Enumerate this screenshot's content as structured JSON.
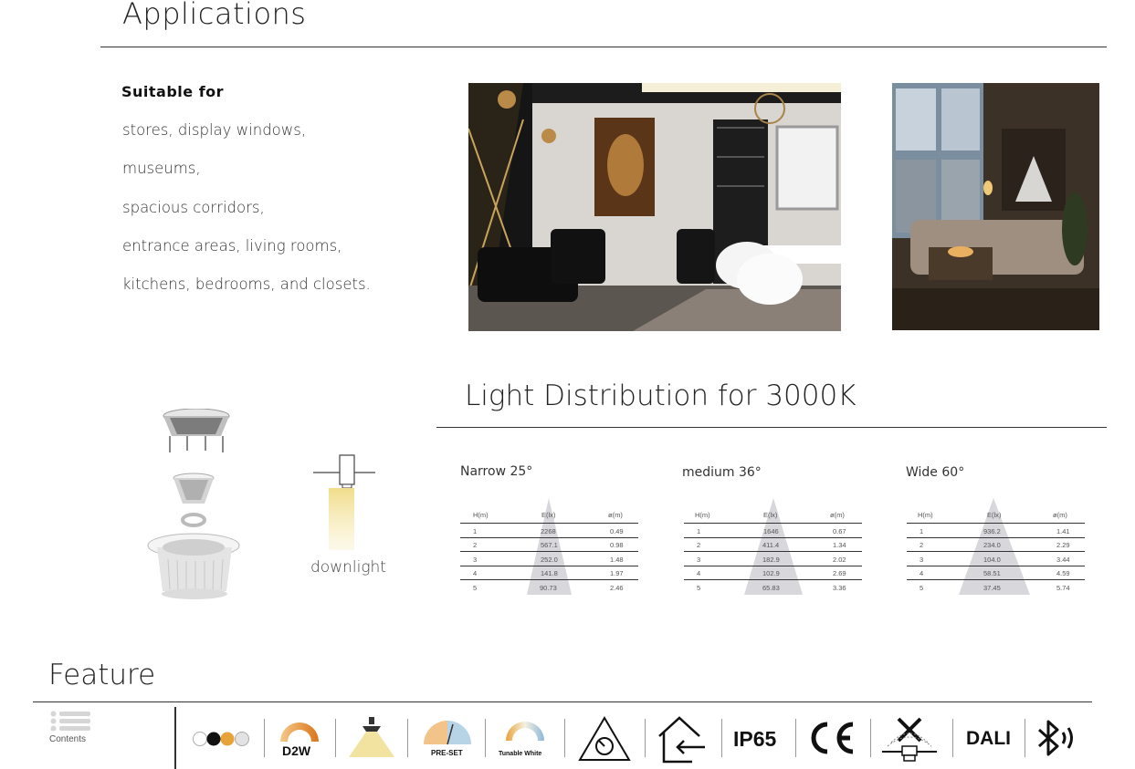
{
  "applications": {
    "title": "Applications",
    "suitable_heading": "Suitable  for",
    "suitable_items": [
      "stores, display windows,",
      " museums,",
      "spacious corridors,",
      "entrance areas, living rooms,",
      "kitchens, bedrooms, and closets."
    ]
  },
  "light_distribution": {
    "title": "Light Distribution for 3000K",
    "downlight_label": "downlight",
    "headers": [
      "H(m)",
      "E(lx)",
      "ø(m)"
    ],
    "beams": [
      {
        "label": "Narrow 25°",
        "rows": [
          [
            "1",
            "2268",
            "0.49"
          ],
          [
            "2",
            "567.1",
            "0.98"
          ],
          [
            "3",
            "252.0",
            "1.48"
          ],
          [
            "4",
            "141.8",
            "1.97"
          ],
          [
            "5",
            "90.73",
            "2.46"
          ]
        ]
      },
      {
        "label": "medium 36°",
        "rows": [
          [
            "1",
            "1646",
            "0.67"
          ],
          [
            "2",
            "411.4",
            "1.34"
          ],
          [
            "3",
            "182.9",
            "2.02"
          ],
          [
            "4",
            "102.9",
            "2.69"
          ],
          [
            "5",
            "65.83",
            "3.36"
          ]
        ]
      },
      {
        "label": "Wide 60°",
        "rows": [
          [
            "1",
            "936.2",
            "1.41"
          ],
          [
            "2",
            "234.0",
            "2.29"
          ],
          [
            "3",
            "104.0",
            "3.44"
          ],
          [
            "4",
            "58.51",
            "4.59"
          ],
          [
            "5",
            "37.45",
            "5.74"
          ]
        ]
      }
    ]
  },
  "feature": {
    "title": "Feature",
    "contents_label": "Contents",
    "icons": {
      "color_dots": "color-temperature-dots-icon",
      "d2w": "D2W",
      "preset": "PRE-SET",
      "tunable": "Tunable White",
      "ip65": "IP65",
      "ce": "CE",
      "dali": "DALI"
    },
    "colors": {
      "warm": "#e8a23a",
      "cool": "#8fb8d8",
      "beam": "#f3e3a0"
    }
  }
}
